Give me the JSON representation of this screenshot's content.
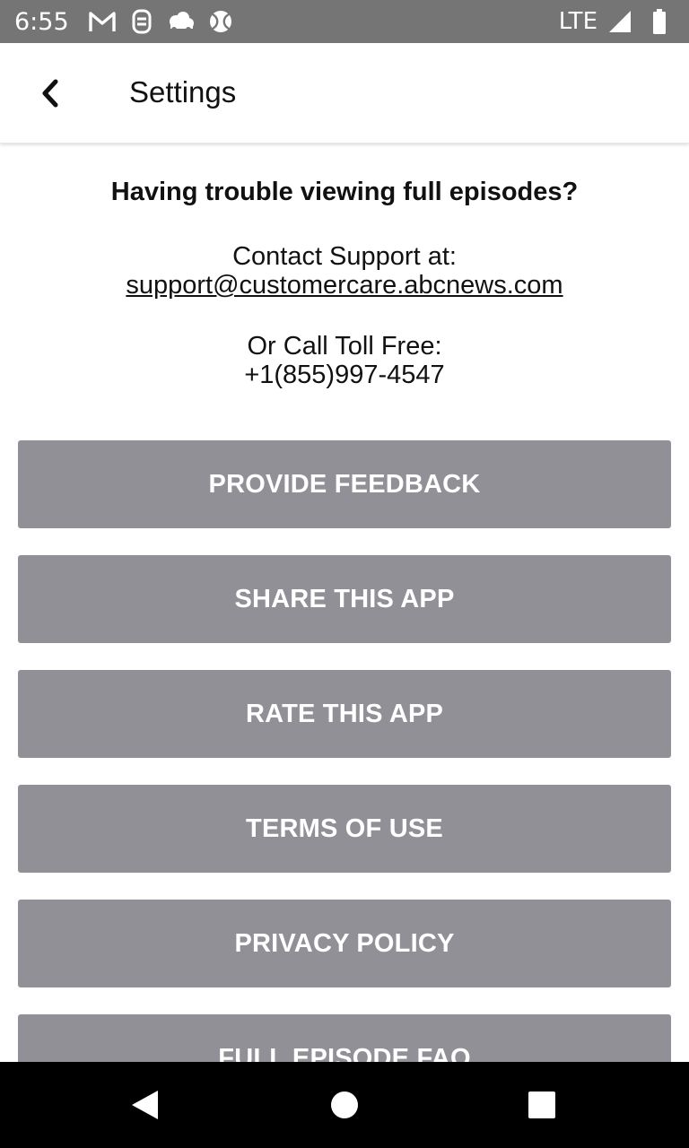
{
  "status_bar": {
    "time": "6:55",
    "network": "LTE",
    "icons": [
      "gmail-icon",
      "notification-icon",
      "cloud-icon",
      "ball-icon",
      "signal-icon",
      "battery-icon"
    ]
  },
  "app_bar": {
    "back_label": "❮",
    "title": "Settings"
  },
  "help": {
    "heading": "Having trouble viewing full episodes?",
    "contact_label": "Contact Support at:",
    "email": "support@customercare.abcnews.com",
    "call_label": "Or Call Toll Free:",
    "phone": "+1(855)997-4547"
  },
  "buttons": [
    {
      "label": "PROVIDE FEEDBACK"
    },
    {
      "label": "SHARE THIS APP"
    },
    {
      "label": "RATE THIS APP"
    },
    {
      "label": "TERMS OF USE"
    },
    {
      "label": "PRIVACY POLICY"
    },
    {
      "label": "FULL EPISODE FAQ"
    }
  ],
  "colors": {
    "status_bar": "#757575",
    "button": "#919096",
    "nav_bar": "#000000"
  }
}
